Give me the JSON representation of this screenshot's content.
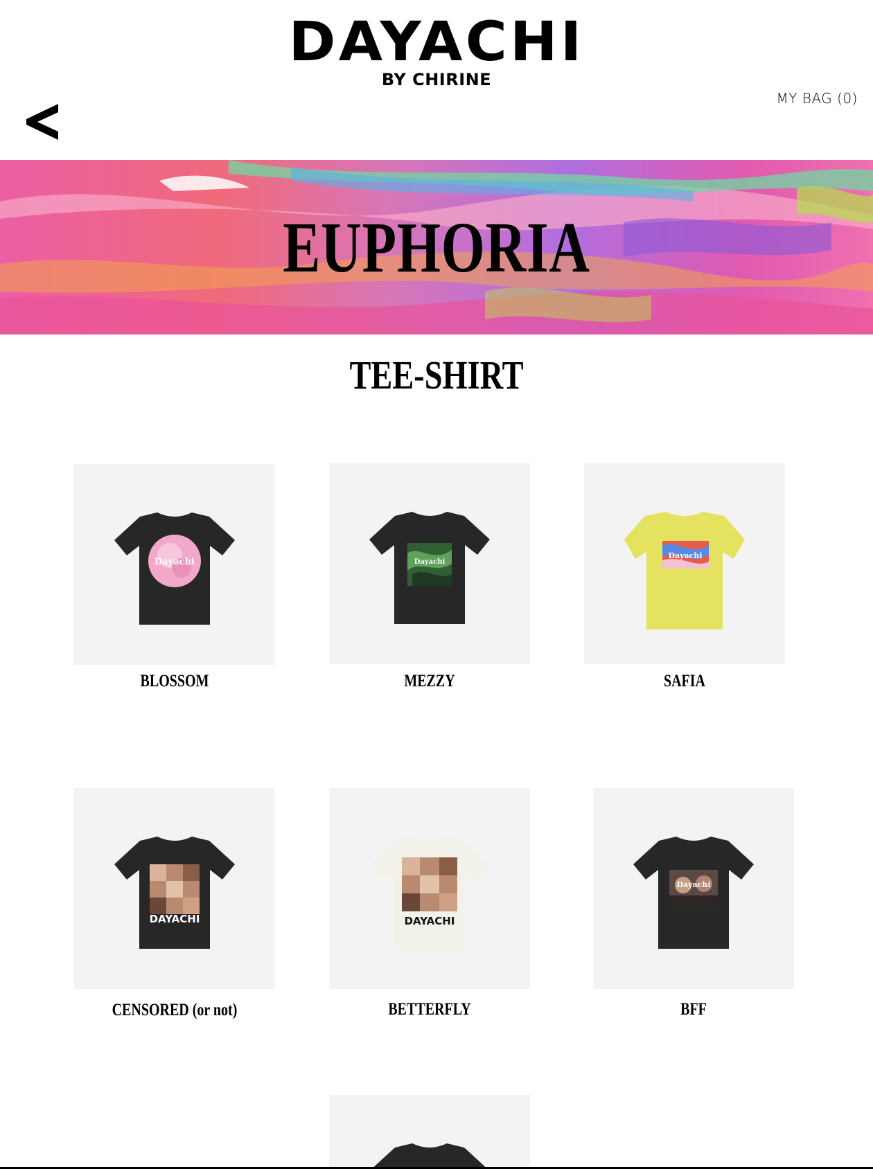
{
  "header": {
    "logo_main": "DAYACHI",
    "logo_sub": "BY CHIRINE",
    "bag_label": "MY BAG (0)",
    "back_icon": "chevron-left-icon"
  },
  "hero": {
    "title": "EUPHORIA"
  },
  "section": {
    "title": "TEE-SHIRT"
  },
  "products": [
    {
      "name": "BLOSSOM",
      "shirt_color": "#272727",
      "print": "pink-rose",
      "print_text": "Dayachi"
    },
    {
      "name": "MEZZY",
      "shirt_color": "#272727",
      "print": "green-marble",
      "print_text": "Dayachi"
    },
    {
      "name": "SAFIA",
      "shirt_color": "#e4e25e",
      "print": "color-swirl",
      "print_text": "Dayachi"
    },
    {
      "name": "CENSORED (or not)",
      "shirt_color": "#272727",
      "print": "photo-collage",
      "print_text": "DAYACHI"
    },
    {
      "name": "BETTERFLY",
      "shirt_color": "#f2f1ea",
      "print": "photo-collage",
      "print_text": "DAYACHI"
    },
    {
      "name": "BFF",
      "shirt_color": "#272727",
      "print": "photo",
      "print_text": "Dayachi"
    },
    {
      "name": "",
      "shirt_color": "#272727",
      "print": "none",
      "print_text": ""
    }
  ]
}
